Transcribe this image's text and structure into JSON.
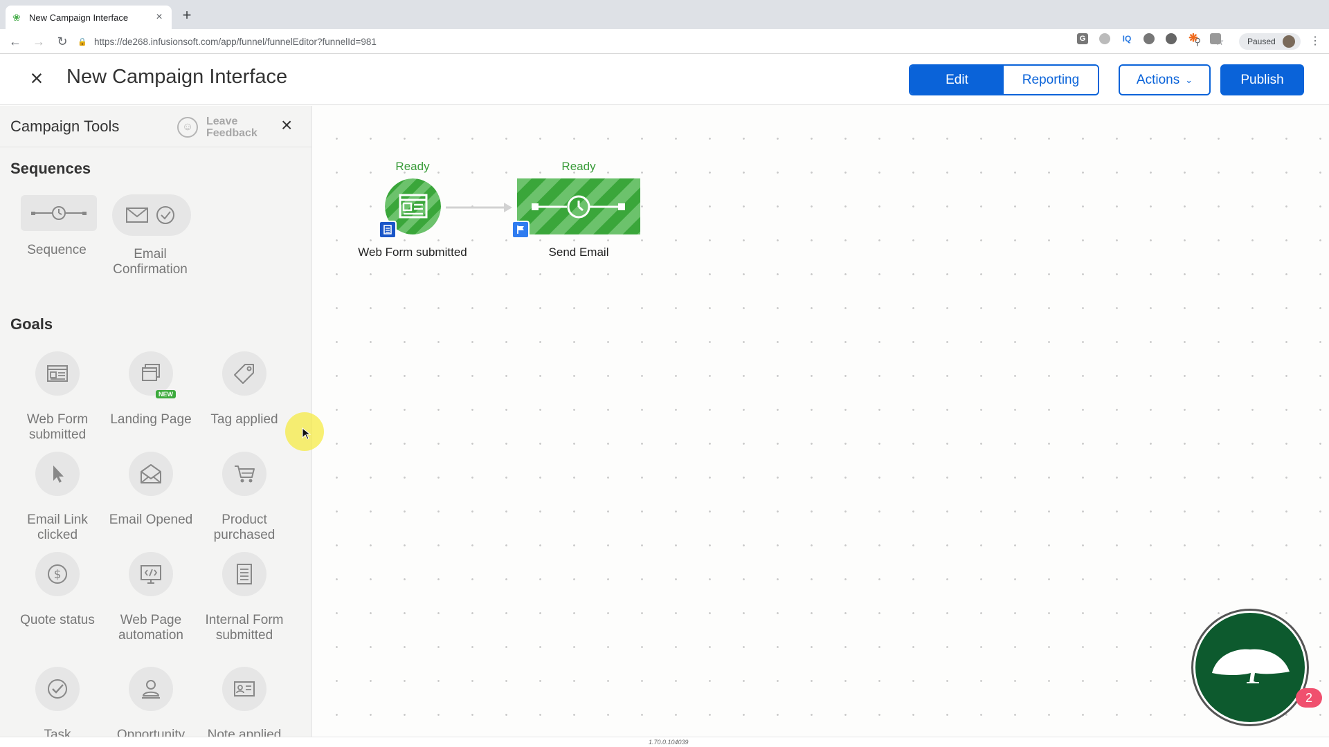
{
  "browser": {
    "tab_title": "New Campaign Interface",
    "url": "https://de268.infusionsoft.com/app/funnel/funnelEditor?funnelId=981",
    "profile_status": "Paused"
  },
  "header": {
    "title": "New Campaign Interface",
    "edit_label": "Edit",
    "reporting_label": "Reporting",
    "actions_label": "Actions",
    "publish_label": "Publish"
  },
  "sidebar": {
    "title": "Campaign Tools",
    "feedback_label": "Leave Feedback",
    "sequences_title": "Sequences",
    "sequences": [
      {
        "label": "Sequence",
        "icon": "sequence-icon"
      },
      {
        "label": "Email Confirmation",
        "icon": "email-confirmation-icon"
      }
    ],
    "goals_title": "Goals",
    "goals": [
      {
        "label": "Web Form submitted",
        "icon": "web-form-icon"
      },
      {
        "label": "Landing Page",
        "icon": "landing-page-icon",
        "badge": "NEW"
      },
      {
        "label": "Tag applied",
        "icon": "tag-icon"
      },
      {
        "label": "Email Link clicked",
        "icon": "cursor-icon"
      },
      {
        "label": "Email Opened",
        "icon": "open-envelope-icon"
      },
      {
        "label": "Product purchased",
        "icon": "cart-icon"
      },
      {
        "label": "Quote status",
        "icon": "dollar-icon"
      },
      {
        "label": "Web Page automation",
        "icon": "code-screen-icon"
      },
      {
        "label": "Internal Form submitted",
        "icon": "document-icon"
      },
      {
        "label": "Task",
        "icon": "check-icon"
      },
      {
        "label": "Opportunity",
        "icon": "person-icon"
      },
      {
        "label": "Note applied",
        "icon": "contact-card-icon"
      }
    ]
  },
  "canvas": {
    "nodes": [
      {
        "status": "Ready",
        "name": "Web Form submitted"
      },
      {
        "status": "Ready",
        "name": "Send Email"
      }
    ],
    "version": "1.70.0.104039"
  },
  "chat_widget": {
    "notification_count": "2"
  },
  "colors": {
    "primary": "#0a63d9",
    "ready_green": "#3a9c3a",
    "node_green": "#3aa63a",
    "badge_blue": "#1a56c8"
  }
}
